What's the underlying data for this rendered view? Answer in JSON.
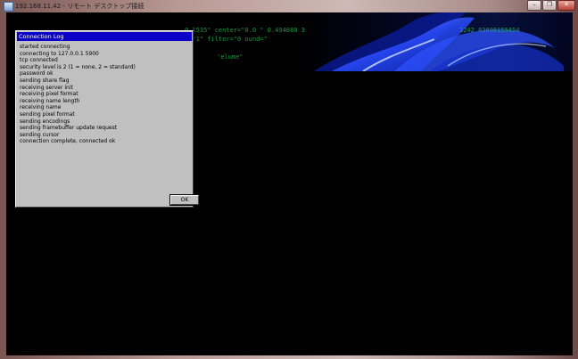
{
  "window": {
    "title": "192.168.11.42 - リモート デスクトップ接続",
    "minimize_glyph": "–",
    "restore_glyph": "❐",
    "close_glyph": "✕"
  },
  "remote_desktop": {
    "code_lines": [
      "0 1535\"   center=\"0.0             \" 0.494080 3",
      "e=\"1\"  filter=\"0                         ound=\"",
      "'elume\"",
      "1242 83698155454"
    ]
  },
  "dialog": {
    "title": "Connection Log",
    "log_lines": [
      "started connecting",
      "connecting to 127.0.0.1 5900",
      "tcp connected",
      "security level is 2 (1 = none, 2 = standard)",
      "password ok",
      "sending share flag",
      "receiving server init",
      "receiving pixel format",
      "receiving name length",
      "receiving name",
      "sending pixel format",
      "sending encodings",
      "sending framebuffer update request",
      "sending cursor",
      "connection complete, connected ok"
    ],
    "ok_label": "OK"
  }
}
